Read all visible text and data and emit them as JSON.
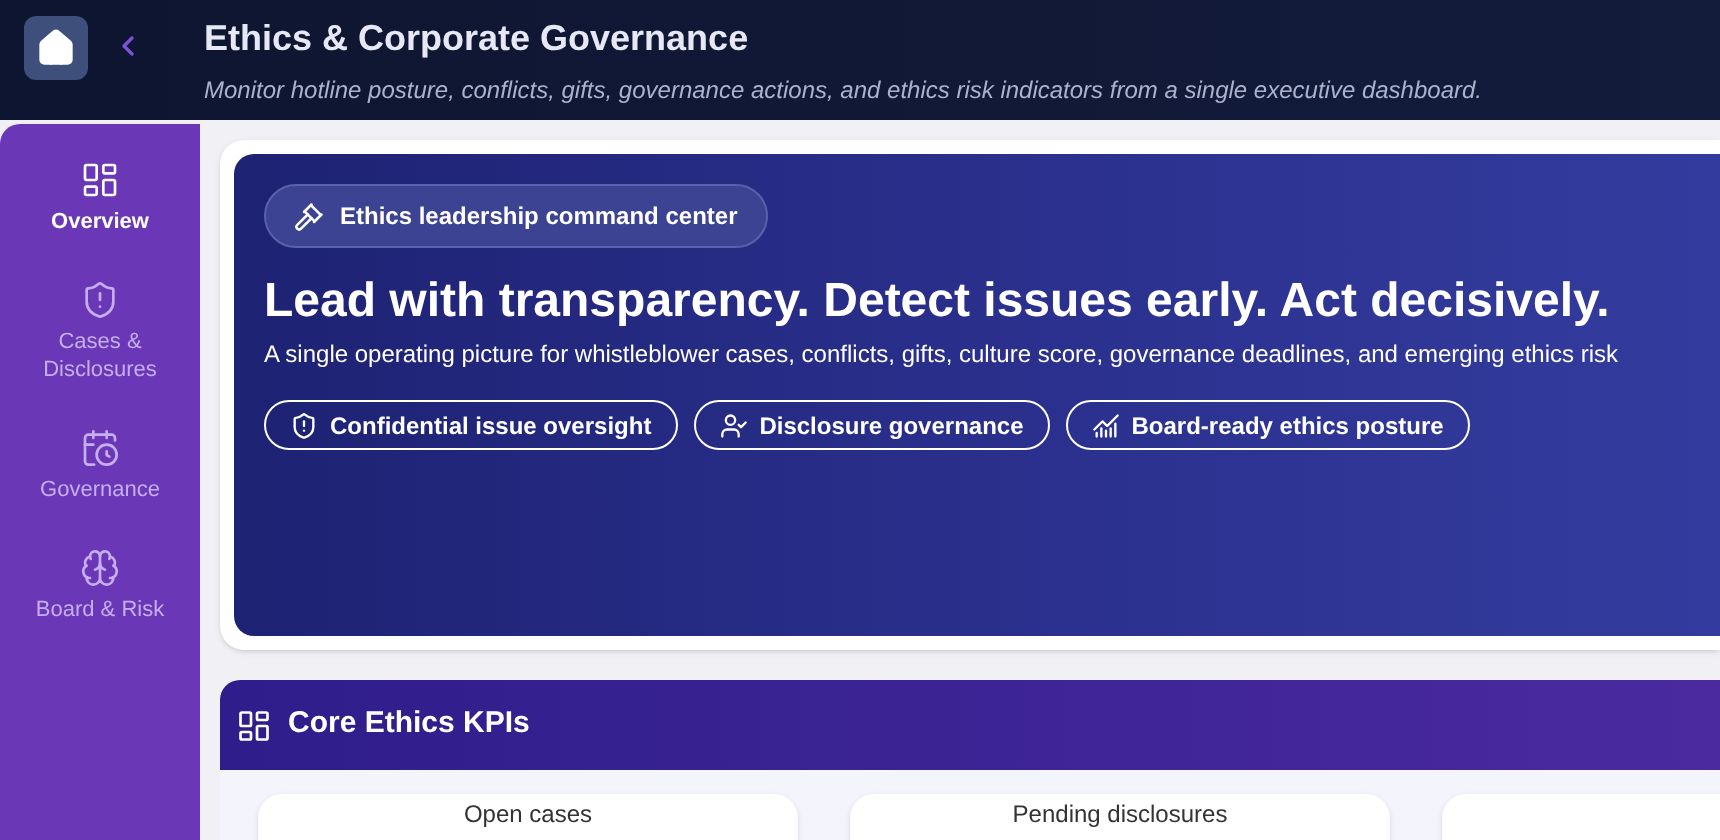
{
  "header": {
    "title": "Ethics & Corporate Governance",
    "subtitle": "Monitor hotline posture, conflicts, gifts, governance actions, and ethics risk indicators from a single executive dashboard."
  },
  "sidebar": {
    "items": [
      {
        "label": "Overview",
        "selected": true
      },
      {
        "label": "Cases & Disclosures",
        "selected": false
      },
      {
        "label": "Governance",
        "selected": false
      },
      {
        "label": "Board & Risk",
        "selected": false
      }
    ]
  },
  "hero": {
    "badge": "Ethics leadership command center",
    "headline": "Lead with transparency. Detect issues early. Act decisively.",
    "description": "A single operating picture for whistleblower cases, conflicts, gifts, culture score, governance deadlines, and emerging ethics risk",
    "pills": [
      {
        "label": "Confidential issue oversight"
      },
      {
        "label": "Disclosure governance"
      },
      {
        "label": "Board-ready ethics posture"
      }
    ]
  },
  "kpis": {
    "title": "Core Ethics KPIs",
    "cards": [
      {
        "label": "Open cases"
      },
      {
        "label": "Pending disclosures"
      }
    ]
  }
}
